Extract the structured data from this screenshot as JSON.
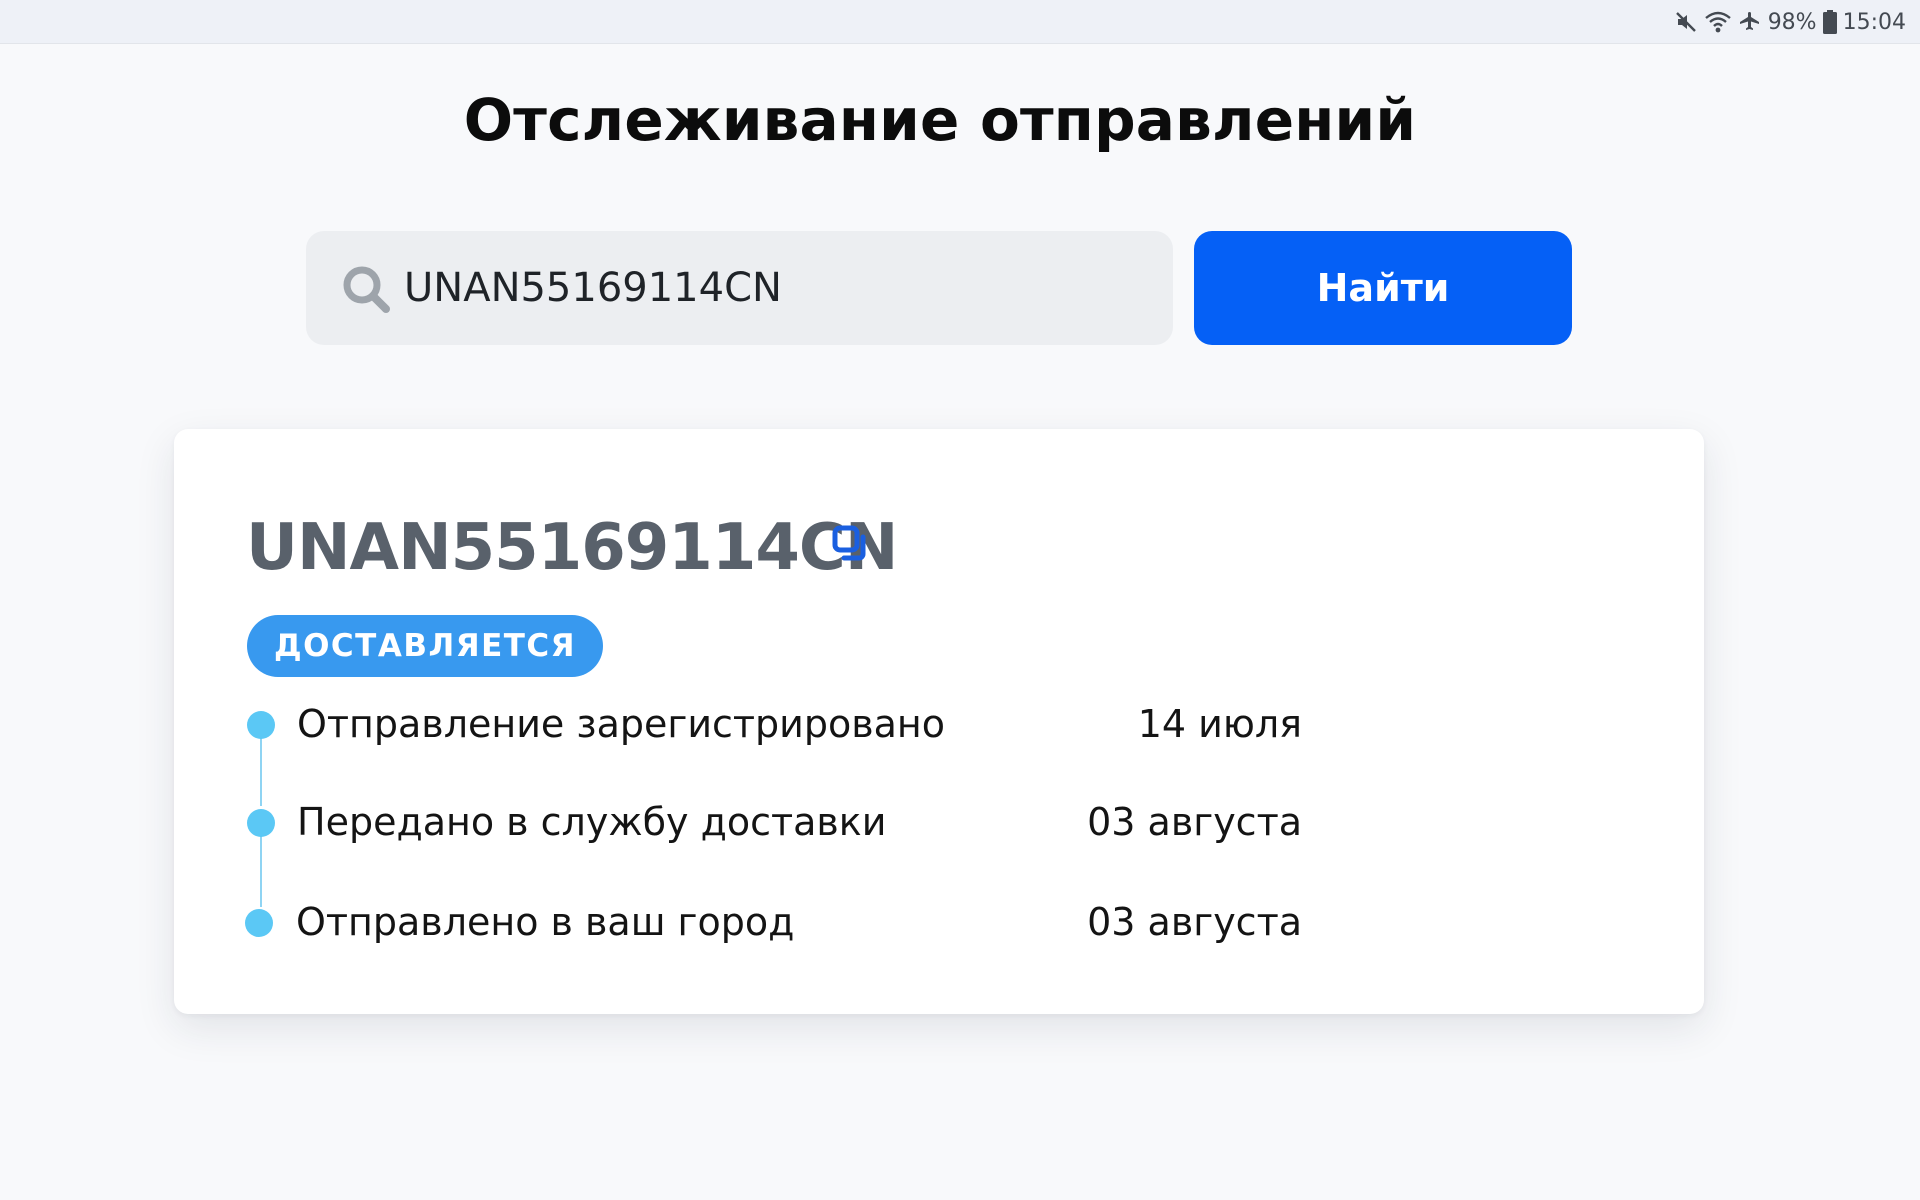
{
  "status_bar": {
    "battery": "98%",
    "time": "15:04",
    "icons": [
      "mute-icon",
      "wifi-icon",
      "airplane-icon",
      "battery-icon"
    ]
  },
  "page": {
    "title": "Отслеживание отправлений"
  },
  "search": {
    "value": "UNAN55169114CN",
    "button_label": "Найти"
  },
  "shipment": {
    "track_number": "UNAN55169114CN",
    "status": "ДОСТАВЛЯЕТСЯ",
    "events": [
      {
        "label": "Отправление зарегистрировано",
        "date": "14 июля"
      },
      {
        "label": "Передано в службу доставки",
        "date": "03 августа"
      },
      {
        "label": "Отправлено в ваш город",
        "date": "03 августа"
      }
    ]
  },
  "colors": {
    "accent": "#0560f6",
    "badge": "#3899ef",
    "timeline_dot": "#5bc8f5",
    "timeline_line": "#8fd4f3"
  }
}
